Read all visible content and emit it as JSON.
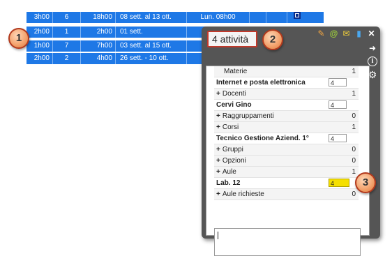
{
  "schedule": {
    "rows": [
      {
        "hours": "3h00",
        "count": "6",
        "total": "18h00",
        "period": "08 sett. al 13 ott.",
        "day": "Lun. 08h00",
        "selected": true
      },
      {
        "hours": "2h00",
        "count": "1",
        "total": "2h00",
        "period": "01 sett.",
        "day": "",
        "selected": false
      },
      {
        "hours": "1h00",
        "count": "7",
        "total": "7h00",
        "period": "03 sett. al 15 ott.",
        "day": "",
        "selected": false
      },
      {
        "hours": "2h00",
        "count": "2",
        "total": "4h00",
        "period": "26 sett. - 10 ott.",
        "day": "",
        "selected": false
      }
    ]
  },
  "callouts": {
    "one": "1",
    "two": "2",
    "three": "3"
  },
  "popup": {
    "title": "4 attività",
    "header_icons": [
      "edit-note-icon",
      "at-icon",
      "envelope-icon",
      "phone-icon",
      "close-icon"
    ],
    "side_icons": [
      "arrow-right-icon",
      "info-icon",
      "gear-icon"
    ],
    "rows": [
      {
        "kind": "plain",
        "label": "Materie",
        "value": "1"
      },
      {
        "kind": "grp",
        "label": "Internet e posta elettronica",
        "input": "4"
      },
      {
        "kind": "sub",
        "label": "Docenti",
        "value": "1"
      },
      {
        "kind": "grp",
        "label": "Cervi Gino",
        "input": "4"
      },
      {
        "kind": "sub",
        "label": "Raggruppamenti",
        "value": "0"
      },
      {
        "kind": "sub",
        "label": "Corsi",
        "value": "1"
      },
      {
        "kind": "grp",
        "label": "Tecnico Gestione Aziend. 1°",
        "input": "4"
      },
      {
        "kind": "sub",
        "label": "Gruppi",
        "value": "0"
      },
      {
        "kind": "sub",
        "label": "Opzioni",
        "value": "0"
      },
      {
        "kind": "sub",
        "label": "Aule",
        "value": "1"
      },
      {
        "kind": "grp",
        "label": "Lab. 12",
        "input": "4",
        "highlight": true
      },
      {
        "kind": "sub",
        "label": "Aule richieste",
        "value": "0"
      }
    ],
    "notes_value": ""
  },
  "colors": {
    "row_blue": "#1e78e6",
    "callout_border": "#b23a1e",
    "highlight": "#f5e000"
  }
}
